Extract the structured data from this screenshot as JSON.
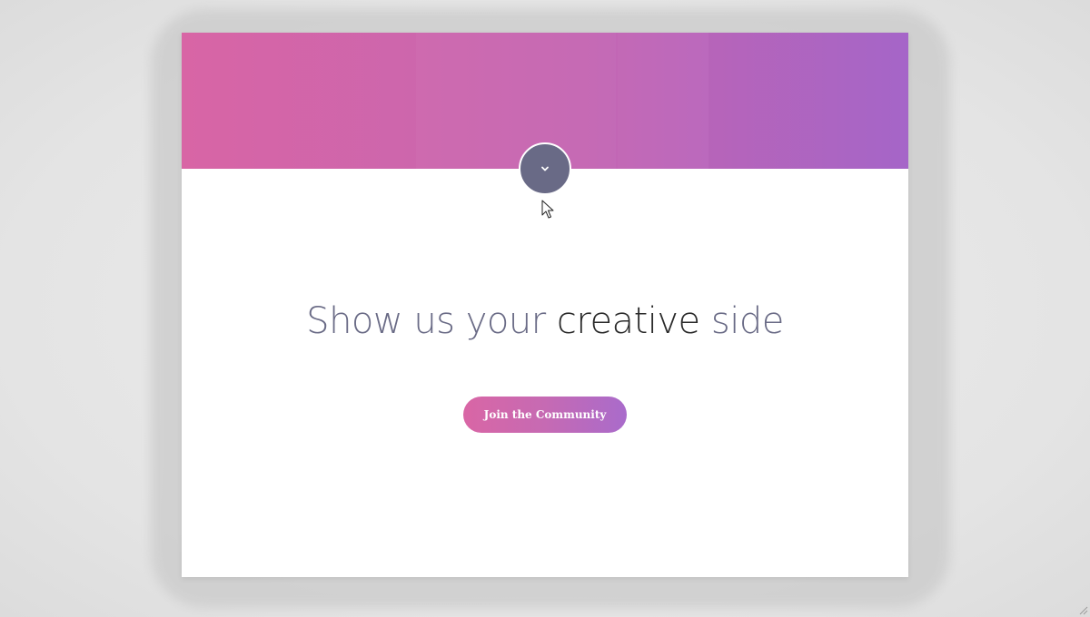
{
  "header": {
    "gradient_colors": [
      "#d865a5",
      "#c566b2",
      "#a867cc"
    ]
  },
  "toggle": {
    "icon": "chevron-down-icon",
    "background": "#696a86"
  },
  "hero": {
    "headline_part1": "Show us your ",
    "headline_accent": "creative",
    "headline_part2": " side",
    "headline_color": "#6a6b86",
    "accent_color": "#2a2a2a"
  },
  "cta": {
    "label": "Join the Community"
  }
}
